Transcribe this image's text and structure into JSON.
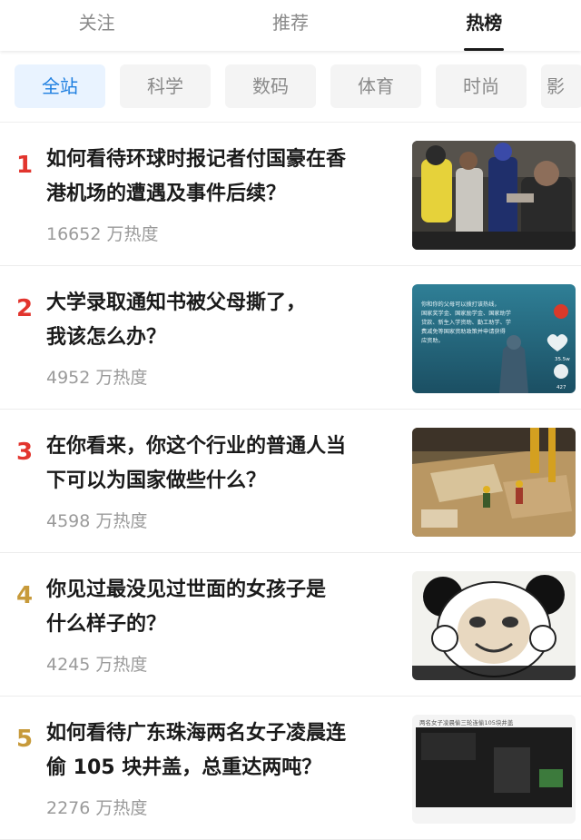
{
  "tabs": [
    {
      "label": "关注"
    },
    {
      "label": "推荐"
    },
    {
      "label": "热榜",
      "active": true
    }
  ],
  "chips": [
    {
      "label": "全站",
      "active": true
    },
    {
      "label": "科学"
    },
    {
      "label": "数码"
    },
    {
      "label": "体育"
    },
    {
      "label": "时尚"
    },
    {
      "label": "影"
    }
  ],
  "items": [
    {
      "rank": "1",
      "title_line1": "如何看待环球时报记者付国豪在香",
      "title_line2": "港机场的遭遇及事件后续？",
      "heat": "16652 万热度"
    },
    {
      "rank": "2",
      "title_line1": "大学录取通知书被父母撕了，",
      "title_line2": "我该怎么办？",
      "heat": "4952 万热度",
      "thumb_text": [
        "你和你的父母可以拨打该热线，",
        "国家奖学金、国家励学金、国家助学",
        "贷款、新生入学资助、勤工助学、学",
        "费减免等国家资助政策并申请获得",
        "应资助。"
      ],
      "thumb_likes": "35.5w",
      "thumb_comments": "427"
    },
    {
      "rank": "3",
      "title_line1": "在你看来，你这个行业的普通人当",
      "title_line2": "下可以为国家做些什么？",
      "heat": "4598 万热度"
    },
    {
      "rank": "4",
      "title_line1": "你见过最没见过世面的女孩子是",
      "title_line2": "什么样子的？",
      "heat": "4245 万热度"
    },
    {
      "rank": "5",
      "title_line1": "如何看待广东珠海两名女子凌晨连",
      "title_line2": "偷 105 块井盖，总重达两吨？",
      "heat": "2276 万热度",
      "thumb_caption": "两名女子凌晨偷三轮连偷105块井盖"
    }
  ],
  "colors": {
    "rank_top": "#e2352e",
    "rank_other": "#c79a3a",
    "chip_active_bg": "#e9f3ff",
    "chip_active_text": "#1e7fe0"
  }
}
